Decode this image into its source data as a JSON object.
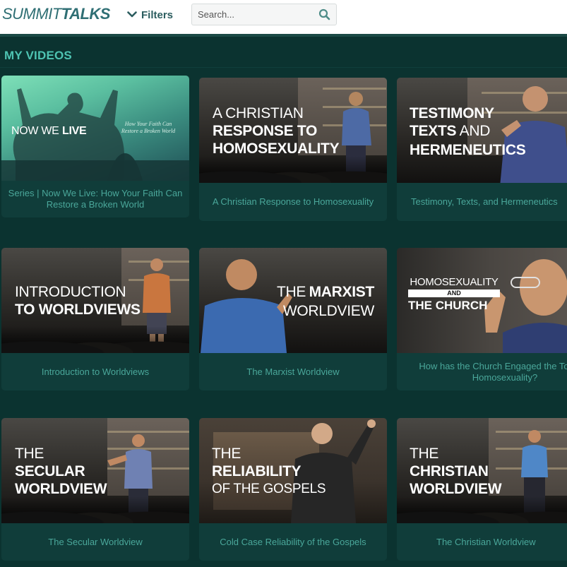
{
  "header": {
    "logo_part1": "SUMMIT",
    "logo_part2": "TALKS",
    "filters_label": "Filters",
    "search_placeholder": "Search..."
  },
  "section": {
    "title": "MY VIDEOS"
  },
  "videos": [
    {
      "caption": "Series  |  Now We Live: How Your Faith Can Restore a Broken World",
      "thumb_title_a": "NOW WE",
      "thumb_title_b": "LIVE",
      "thumb_subtitle": "How Your Faith Can Restore a Broken World"
    },
    {
      "caption": "A Christian Response to Homosexuality",
      "thumb_title_a": "A CHRISTIAN",
      "thumb_title_b": "RESPONSE TO",
      "thumb_title_c": "HOMOSEXUALITY"
    },
    {
      "caption": "Testimony, Texts, and Hermeneutics",
      "thumb_title_a": "TESTIMONY",
      "thumb_title_b": "TEXTS",
      "thumb_title_c": "AND",
      "thumb_title_d": "HERMENEUTICS"
    },
    {
      "caption": "Introduction to Worldviews",
      "thumb_title_a": "INTRODUCTION",
      "thumb_title_b": "TO WORLDVIEWS"
    },
    {
      "caption": "The Marxist Worldview",
      "thumb_title_a": "THE",
      "thumb_title_b": "MARXIST",
      "thumb_title_c": "WORLDVIEW"
    },
    {
      "caption": "How has the Church Engaged the Topic of Homosexuality?",
      "thumb_title_a": "HOMOSEXUALITY",
      "thumb_title_b": "AND",
      "thumb_title_c": "THE CHURCH"
    },
    {
      "caption": "The Secular Worldview",
      "thumb_title_a": "THE",
      "thumb_title_b": "SECULAR",
      "thumb_title_c": "WORLDVIEW"
    },
    {
      "caption": "Cold Case Reliability of the Gospels",
      "thumb_title_a": "THE",
      "thumb_title_b": "RELIABILITY",
      "thumb_title_c": "OF THE GOSPELS"
    },
    {
      "caption": "The Christian Worldview",
      "thumb_title_a": "THE",
      "thumb_title_b": "CHRISTIAN",
      "thumb_title_c": "WORLDVIEW"
    }
  ],
  "colors": {
    "background": "#0b3330",
    "card": "#103d3a",
    "caption_text": "#4aa79a",
    "section_title": "#4ec3b2",
    "logo": "#2f6f74"
  },
  "icons": [
    "chevron-down-icon",
    "search-icon"
  ]
}
